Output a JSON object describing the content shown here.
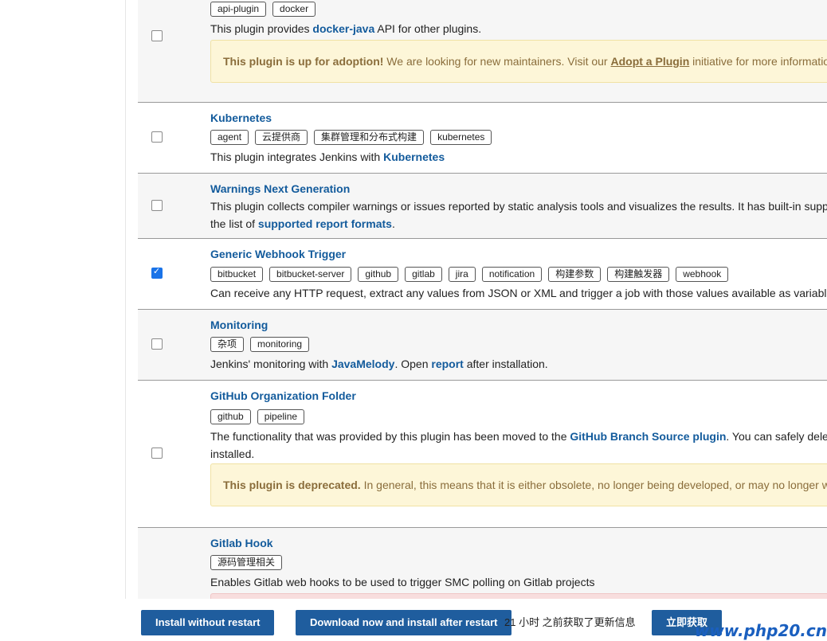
{
  "plugins": [
    {
      "tags": [
        "api-plugin",
        "docker"
      ],
      "desc_prefix": "This plugin provides ",
      "desc_link": "docker-java",
      "desc_suffix": " API for other plugins.",
      "note_strong": "This plugin is up for adoption!",
      "note_text": " We are looking for new maintainers. Visit our ",
      "note_link": "Adopt a Plugin",
      "note_suffix": " initiative for more information."
    },
    {
      "title": "Kubernetes",
      "tags": [
        "agent",
        "云提供商",
        "集群管理和分布式构建",
        "kubernetes"
      ],
      "desc_prefix": "This plugin integrates Jenkins with ",
      "desc_link": "Kubernetes"
    },
    {
      "title": "Warnings Next Generation",
      "desc_line1": "This plugin collects compiler warnings or issues reported by static analysis tools and visualizes the results. It has built-in support for",
      "desc_line2_prefix": "the list of ",
      "desc_line2_link": "supported report formats",
      "desc_line2_suffix": "."
    },
    {
      "title": "Generic Webhook Trigger",
      "tags": [
        "bitbucket",
        "bitbucket-server",
        "github",
        "gitlab",
        "jira",
        "notification",
        "构建参数",
        "构建触发器",
        "webhook"
      ],
      "desc": "Can receive any HTTP request, extract any values from JSON or XML and trigger a job with those values available as variables."
    },
    {
      "title": "Monitoring",
      "tags": [
        "杂项",
        "monitoring"
      ],
      "desc_prefix": "Jenkins' monitoring with ",
      "desc_link": "JavaMelody",
      "desc_mid": ". Open ",
      "desc_link2": "report",
      "desc_suffix": " after installation."
    },
    {
      "title": "GitHub Organization Folder",
      "tags": [
        "github",
        "pipeline"
      ],
      "desc_prefix": "The functionality that was provided by this plugin has been moved to the ",
      "desc_link": "GitHub Branch Source plugin",
      "desc_suffix": ". You can safely delete this plugin once it is",
      "desc_line2": "installed.",
      "note_strong": "This plugin is deprecated.",
      "note_text": " In general, this means that it is either obsolete, no longer being developed, or may no longer work."
    },
    {
      "title": "Gitlab Hook",
      "tags": [
        "源码管理相关"
      ],
      "desc": "Enables Gitlab web hooks to be used to trigger SMC polling on Gitlab projects"
    }
  ],
  "checked": [
    false,
    false,
    false,
    true,
    false,
    false,
    false
  ],
  "bottom": {
    "install_without_restart": "Install without restart",
    "download_install_after_restart": "Download now and install after restart",
    "update_status": "21 小时 之前获取了更新信息",
    "fetch_now": "立即获取"
  },
  "watermark": "www.php20.cn"
}
